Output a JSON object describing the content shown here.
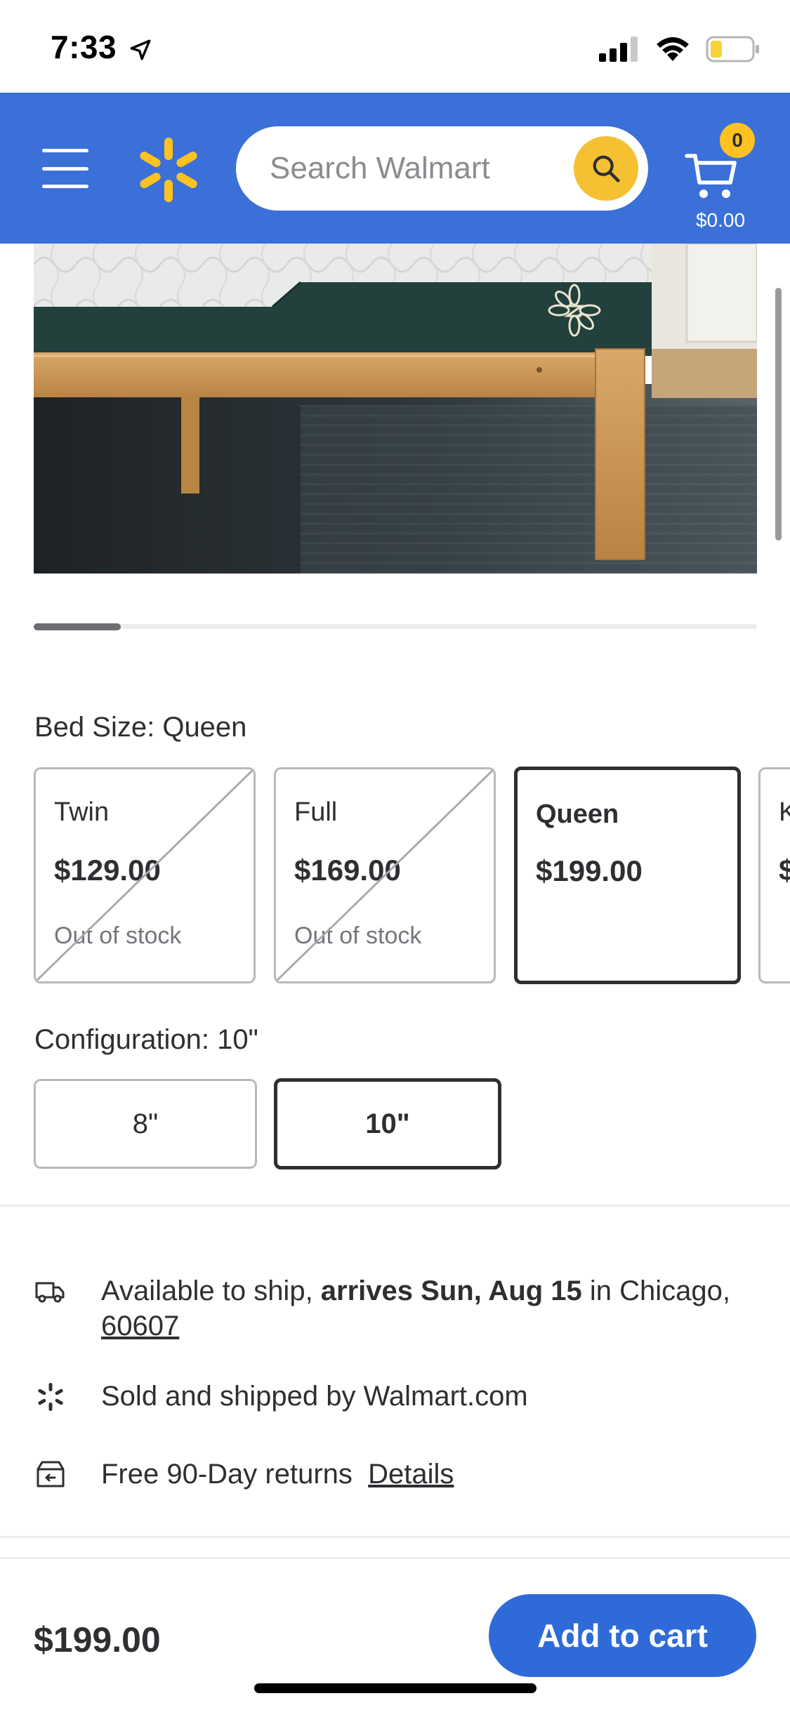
{
  "status_bar": {
    "time": "7:33"
  },
  "header": {
    "search_placeholder": "Search Walmart",
    "cart_count": "0",
    "cart_total": "$0.00"
  },
  "variants": {
    "bed_size_label": "Bed Size: Queen",
    "sizes": [
      {
        "name": "Twin",
        "price": "$129.00",
        "stock": "Out of stock"
      },
      {
        "name": "Full",
        "price": "$169.00",
        "stock": "Out of stock"
      },
      {
        "name": "Queen",
        "price": "$199.00",
        "stock": ""
      },
      {
        "name": "K",
        "price": "$",
        "stock": ""
      }
    ],
    "configuration_label": "Configuration: 10\"",
    "configurations": [
      "8\"",
      "10\""
    ]
  },
  "fulfillment": {
    "ship_prefix": "Available to ship, ",
    "ship_bold": "arrives Sun, Aug 15",
    "ship_suffix": " in Chicago,",
    "zip": "60607",
    "sold_by": "Sold and shipped by Walmart.com",
    "returns": "Free 90-Day returns",
    "details_link": "Details"
  },
  "bottom_bar": {
    "price": "$199.00",
    "add_to_cart": "Add to cart"
  },
  "colors": {
    "brand_blue": "#3a70d8",
    "spark_yellow": "#ffc220",
    "button_blue": "#2f6bd8"
  },
  "carousel": {
    "progress": 0.12
  }
}
